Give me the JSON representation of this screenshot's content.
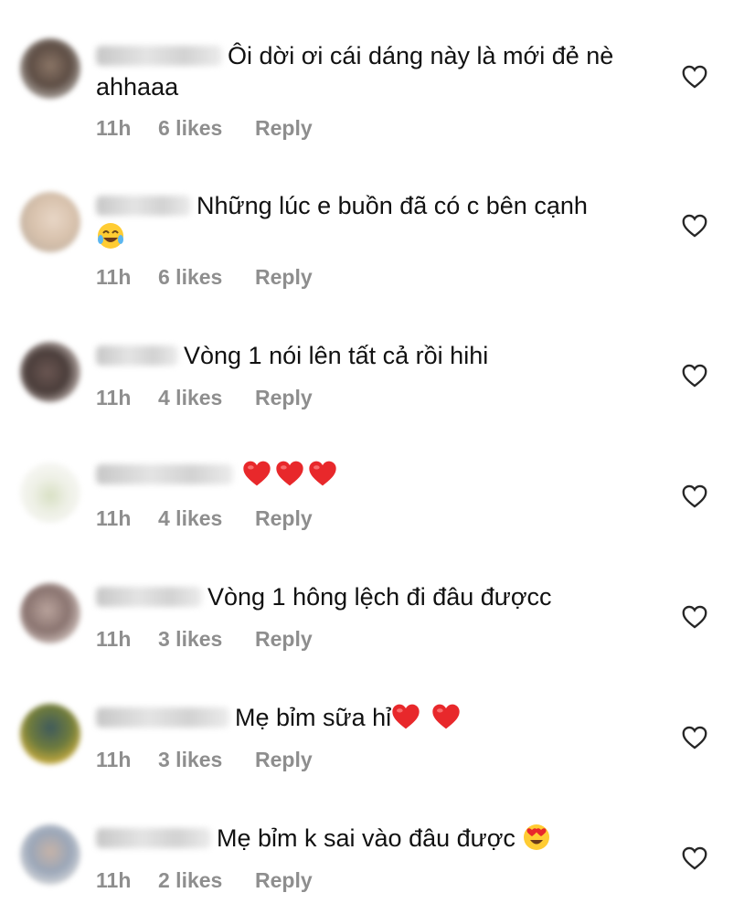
{
  "comments": [
    {
      "text": "Ôi dời ơi cái dáng này là mới đẻ nè ahhaaa",
      "time": "11h",
      "likes": "6 likes",
      "reply": "Reply"
    },
    {
      "text": "Những lúc e buồn đã có c bên cạnh",
      "time": "11h",
      "likes": "6 likes",
      "reply": "Reply"
    },
    {
      "text": "Vòng 1 nói lên tất cả rồi hihi",
      "time": "11h",
      "likes": "4 likes",
      "reply": "Reply"
    },
    {
      "text": "",
      "time": "11h",
      "likes": "4 likes",
      "reply": "Reply"
    },
    {
      "text": "Vòng 1 hông lệch đi đâu đượcc",
      "time": "11h",
      "likes": "3 likes",
      "reply": "Reply"
    },
    {
      "text": "Mẹ bỉm sữa hỉ",
      "time": "11h",
      "likes": "3 likes",
      "reply": "Reply"
    },
    {
      "text": "Mẹ bỉm k sai vào đâu được",
      "time": "11h",
      "likes": "2 likes",
      "reply": "Reply"
    }
  ],
  "icons": {
    "like": "heart-outline-icon",
    "emoji_heart": "red-heart-emoji",
    "emoji_laugh": "tears-of-joy-emoji",
    "emoji_heart_eyes": "heart-eyes-emoji"
  },
  "colors": {
    "text": "#111111",
    "meta": "#8e8e8e",
    "heart_outline": "#262626",
    "emoji_red": "#e8282b",
    "emoji_yellow": "#ffcc33"
  }
}
